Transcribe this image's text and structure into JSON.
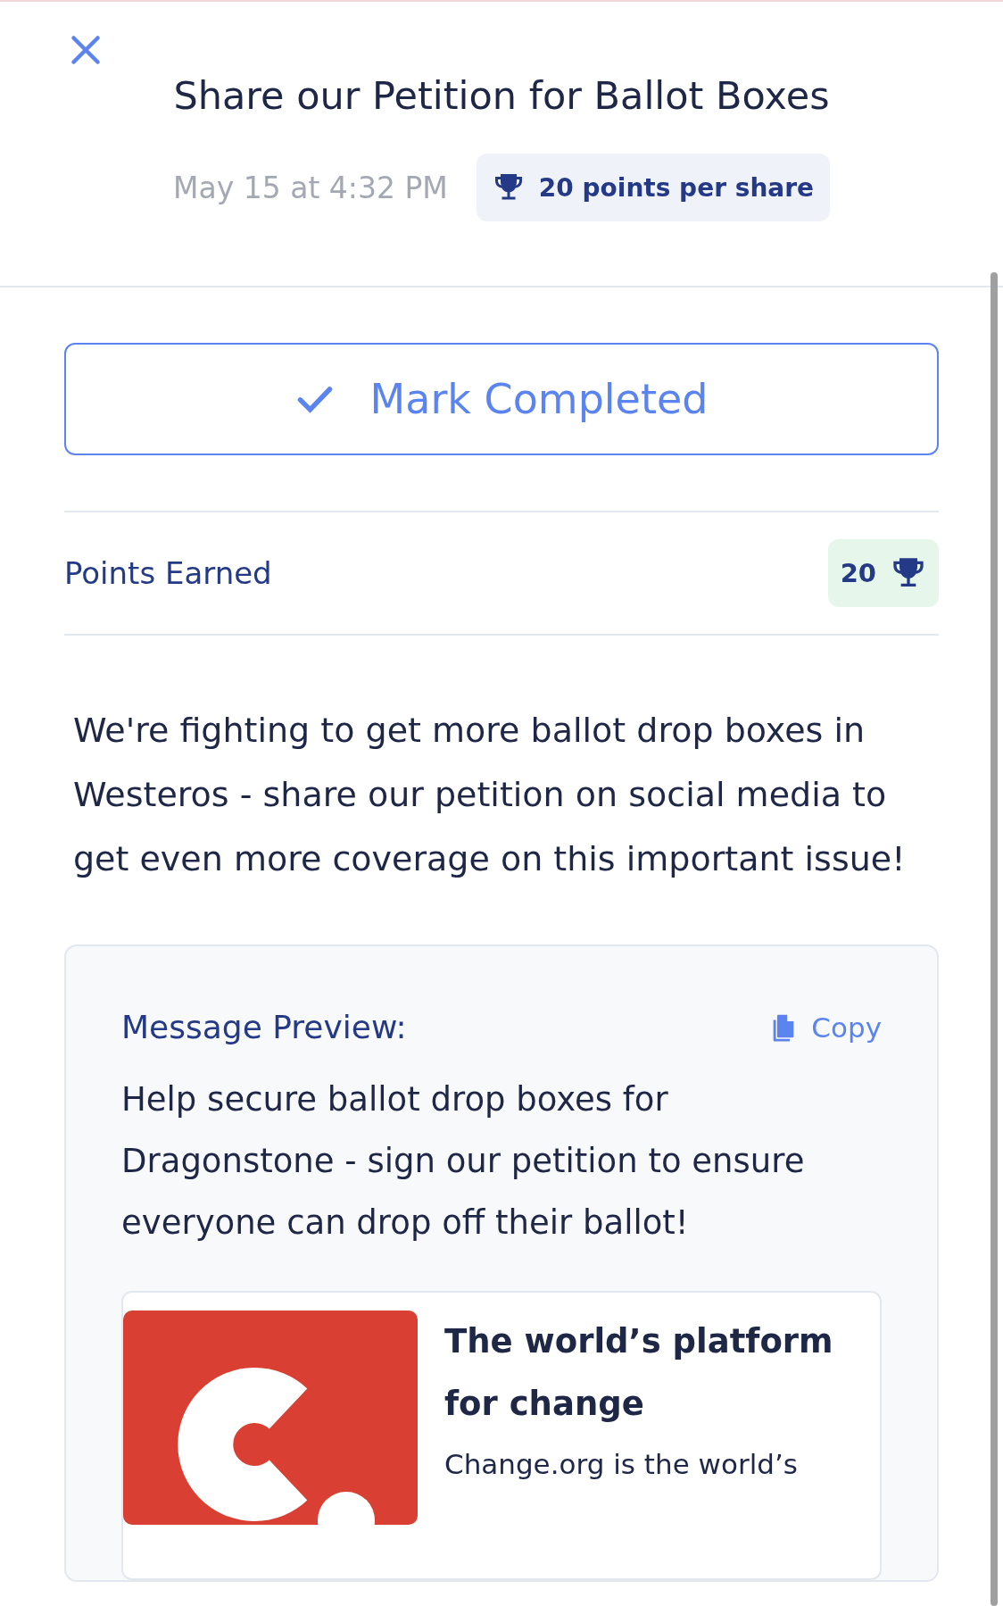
{
  "header": {
    "title": "Share our Petition for Ballot Boxes",
    "date": "May 15 at 4:32 PM",
    "points_badge": "20 points per share"
  },
  "mark_button": {
    "label": "Mark Completed",
    "completed": false
  },
  "points_row": {
    "label": "Points Earned",
    "value": "20"
  },
  "description": "We're fighting to get more ballot drop boxes in Westeros - share our petition on social media to get even more coverage on this important issue!",
  "preview": {
    "heading": "Message Preview:",
    "copy_label": "Copy",
    "message": "Help secure ballot drop boxes for Dragonstone - sign our petition to ensure everyone can drop off their ballot!",
    "link_card": {
      "title": "The world’s platform for change",
      "text": "Change.org is the world’s"
    }
  }
}
